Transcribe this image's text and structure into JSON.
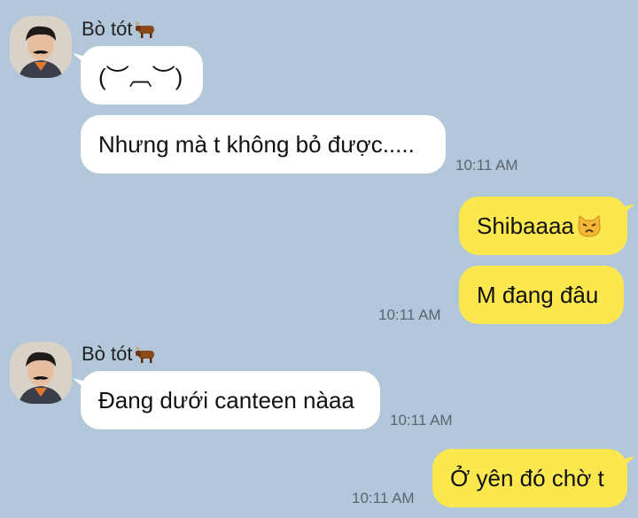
{
  "messages": [
    {
      "sender": "Bò tót",
      "text": "(︶︹︶)"
    },
    {
      "text": "Nhưng mà t không bỏ được.....",
      "time": "10:11 AM"
    },
    {
      "text": "Shibaaaa",
      "emoji": "pouting-cat-emoji"
    },
    {
      "text": "M đang đâu",
      "time": "10:11 AM"
    },
    {
      "sender": "Bò tót",
      "text": "Đang dưới canteen nàaa",
      "time": "10:11 AM"
    },
    {
      "text": "Ở yên đó chờ t",
      "time": "10:11 AM"
    }
  ],
  "colors": {
    "background": "#b2c7da",
    "incoming_bubble": "#ffffff",
    "outgoing_bubble": "#fbe74e"
  },
  "icons": {
    "sender_badge": "ox-emoji"
  }
}
